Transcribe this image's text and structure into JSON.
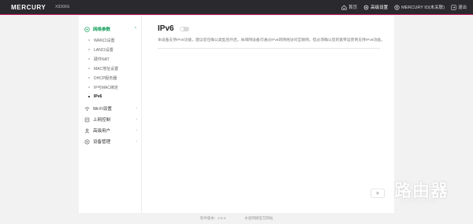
{
  "header": {
    "brand": "MERCURY",
    "model": "X9300G",
    "links": [
      {
        "label": "首页",
        "icon": "home-icon"
      },
      {
        "label": "高级设置",
        "icon": "settings-icon",
        "active": true
      },
      {
        "label": "MERCURY ID(未关联)",
        "icon": "account-icon"
      },
      {
        "label": "退出",
        "icon": "logout-icon"
      }
    ]
  },
  "sidebar": {
    "sections": [
      {
        "label": "网络参数",
        "icon": "network-icon",
        "open": true,
        "items": [
          {
            "label": "WAN口设置"
          },
          {
            "label": "LAN口设置"
          },
          {
            "label": "硬件NAT"
          },
          {
            "label": "MAC地址设置"
          },
          {
            "label": "DHCP服务器"
          },
          {
            "label": "IP与MAC绑定"
          },
          {
            "label": "IPv6",
            "active": true
          }
        ]
      },
      {
        "label": "Wi-Fi设置",
        "icon": "wifi-icon"
      },
      {
        "label": "上网控制",
        "icon": "control-icon"
      },
      {
        "label": "高级用户",
        "icon": "user-icon"
      },
      {
        "label": "设备管理",
        "icon": "device-icon"
      }
    ]
  },
  "main": {
    "title": "IPv6",
    "toggle_on": false,
    "description": "本设备支持IPv6功能，建议您在确认类型后开启，局域网设备可通过IPv6的网络访问互联网，但必须确认您的宽带运营商支持IPv6功能。"
  },
  "footer": {
    "version": "软件版本：2.0.4",
    "service": "水星网络官方网站"
  },
  "watermark": {
    "text": "路由器",
    "sub": "luyouqi.com"
  },
  "colors": {
    "accent": "#0f9d58",
    "topbar": "#2a2a2e",
    "topbar_border": "#c2185b"
  }
}
